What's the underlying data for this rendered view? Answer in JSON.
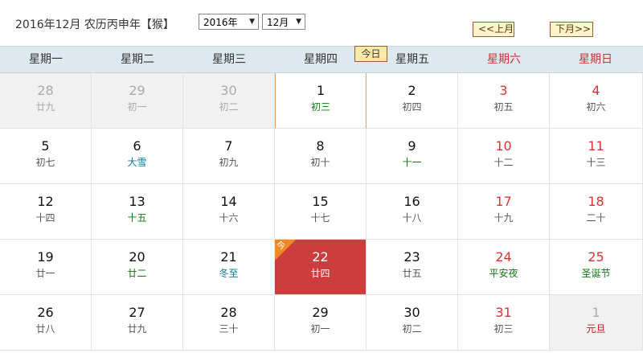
{
  "header": {
    "title": "2016年12月 农历丙申年【猴】",
    "year_select": "2016年",
    "month_select": "12月",
    "prev_label": "<<上月",
    "next_label": "下月>>",
    "today_label": "今日"
  },
  "weekdays": [
    "星期一",
    "星期二",
    "星期三",
    "星期四",
    "星期五",
    "星期六",
    "星期日"
  ],
  "colors": {
    "weekend": "#dd3333",
    "today_bg": "#cc3d3d",
    "corner": "#f08a24",
    "festival_red": "#c01818",
    "lunar_green": "#117711",
    "solar_term_teal": "#107a9e"
  },
  "today_corner_label": "今",
  "weeks": [
    [
      {
        "day": "28",
        "lunar": "廿九",
        "other": true
      },
      {
        "day": "29",
        "lunar": "初一",
        "other": true
      },
      {
        "day": "30",
        "lunar": "初二",
        "other": true
      },
      {
        "day": "1",
        "lunar": "初三",
        "style": "green",
        "selected": true
      },
      {
        "day": "2",
        "lunar": "初四"
      },
      {
        "day": "3",
        "lunar": "初五",
        "weekend": true
      },
      {
        "day": "4",
        "lunar": "初六",
        "weekend": true
      }
    ],
    [
      {
        "day": "5",
        "lunar": "初七"
      },
      {
        "day": "6",
        "lunar": "大雪",
        "style": "teal"
      },
      {
        "day": "7",
        "lunar": "初九"
      },
      {
        "day": "8",
        "lunar": "初十"
      },
      {
        "day": "9",
        "lunar": "十一",
        "style": "green"
      },
      {
        "day": "10",
        "lunar": "十二",
        "weekend": true
      },
      {
        "day": "11",
        "lunar": "十三",
        "weekend": true
      }
    ],
    [
      {
        "day": "12",
        "lunar": "十四"
      },
      {
        "day": "13",
        "lunar": "十五",
        "style": "green"
      },
      {
        "day": "14",
        "lunar": "十六"
      },
      {
        "day": "15",
        "lunar": "十七"
      },
      {
        "day": "16",
        "lunar": "十八"
      },
      {
        "day": "17",
        "lunar": "十九",
        "weekend": true
      },
      {
        "day": "18",
        "lunar": "二十",
        "weekend": true
      }
    ],
    [
      {
        "day": "19",
        "lunar": "廿一"
      },
      {
        "day": "20",
        "lunar": "廿二",
        "style": "green"
      },
      {
        "day": "21",
        "lunar": "冬至",
        "style": "teal"
      },
      {
        "day": "22",
        "lunar": "廿四",
        "today": true
      },
      {
        "day": "23",
        "lunar": "廿五"
      },
      {
        "day": "24",
        "lunar": "平安夜",
        "weekend": true,
        "style": "green"
      },
      {
        "day": "25",
        "lunar": "圣诞节",
        "weekend": true,
        "style": "green"
      }
    ],
    [
      {
        "day": "26",
        "lunar": "廿八"
      },
      {
        "day": "27",
        "lunar": "廿九"
      },
      {
        "day": "28",
        "lunar": "三十"
      },
      {
        "day": "29",
        "lunar": "初一"
      },
      {
        "day": "30",
        "lunar": "初二"
      },
      {
        "day": "31",
        "lunar": "初三",
        "weekend": true
      },
      {
        "day": "1",
        "lunar": "元旦",
        "other": true,
        "style": "red"
      }
    ]
  ]
}
